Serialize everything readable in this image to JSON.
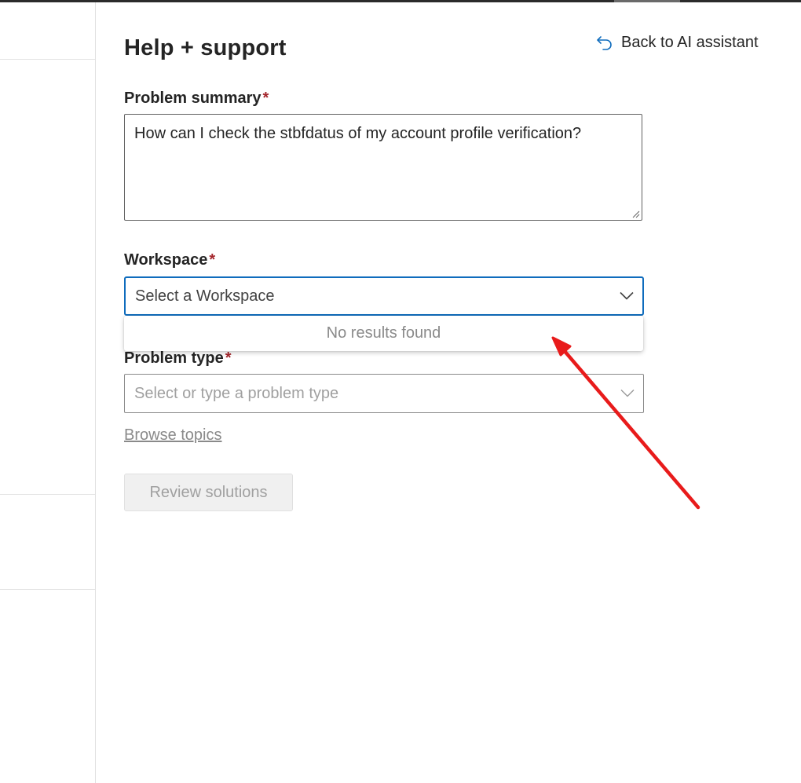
{
  "panel": {
    "title": "Help + support",
    "back_link_label": "Back to AI assistant"
  },
  "form": {
    "summary": {
      "label": "Problem summary",
      "required_mark": "*",
      "value": "How can I check the stbfdatus of my account profile verification?"
    },
    "workspace": {
      "label": "Workspace",
      "required_mark": "*",
      "value": "Select a Workspace",
      "dropdown_message": "No results found"
    },
    "problem_type": {
      "label": "Problem type",
      "required_mark": "*",
      "placeholder": "Select or type a problem type"
    },
    "browse_topics_label": "Browse topics",
    "review_button_label": "Review solutions"
  },
  "colors": {
    "focus_border": "#0f6cbd",
    "required": "#a4262c",
    "annotation_arrow": "#e81b1b"
  },
  "icons": {
    "back": "undo-arrow-icon",
    "dropdown": "chevron-down-icon"
  }
}
